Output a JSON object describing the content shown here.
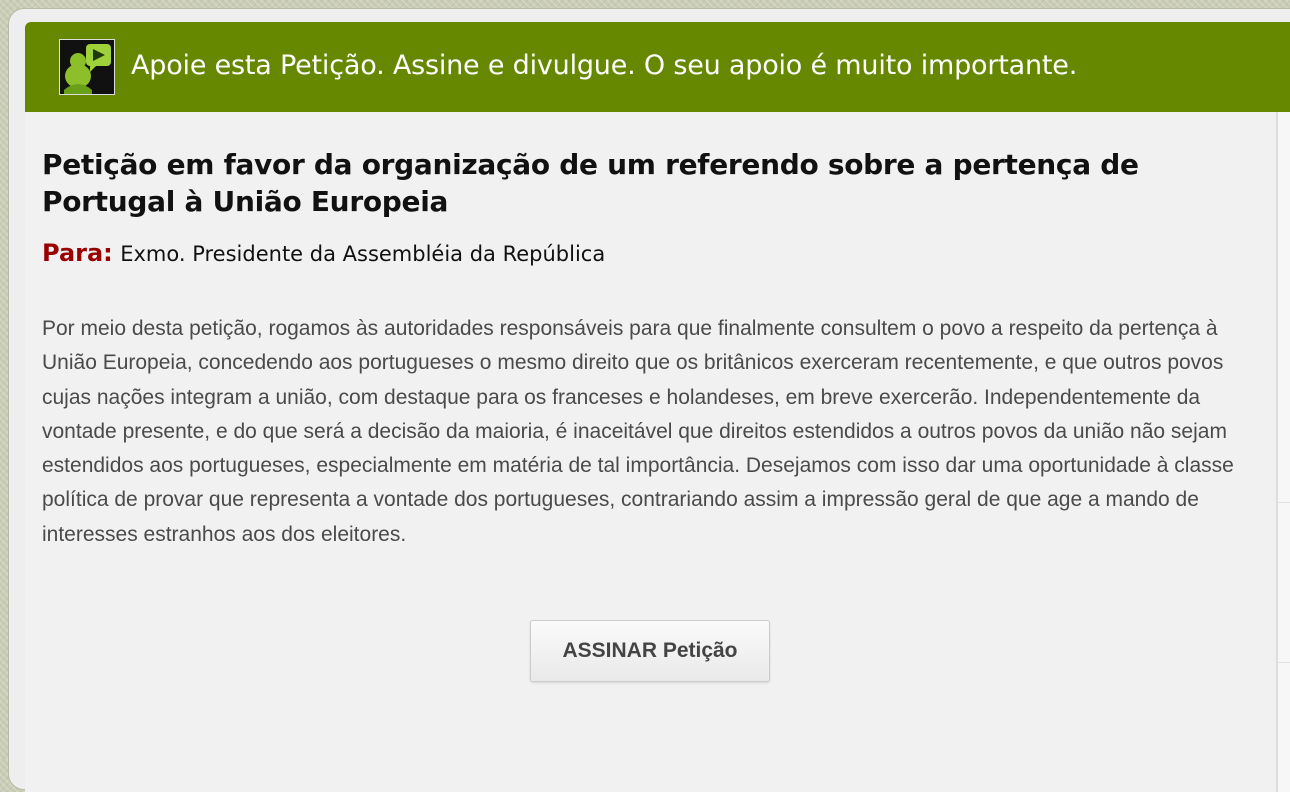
{
  "banner": {
    "icon": "person-play-icon",
    "text": "Apoie esta Petição. Assine e divulgue. O seu apoio é muito importante."
  },
  "petition": {
    "title": "Petição em favor da organização de um referendo sobre a pertença de Portugal à União Europeia",
    "recipient_label": "Para:",
    "recipient_value": "Exmo. Presidente da Assembléia da República",
    "body": "Por meio desta petição, rogamos às autoridades responsáveis para que finalmente consultem o povo a respeito da pertença à União Europeia, concedendo aos portugueses o mesmo direito que os britânicos exerceram recentemente, e que outros povos cujas nações integram a união, com destaque para os franceses e holandeses, em breve exercerão. Independentemente da vontade presente, e do que será a decisão da maioria, é inaceitável que direitos estendidos a outros povos da união não sejam estendidos aos portugueses, especialmente em matéria de tal importância. Desejamos com isso dar uma oportunidade à classe política de provar que representa a vontade dos portugueses, contrariando assim a impressão geral de que age a mando de interesses estranhos aos dos eleitores."
  },
  "actions": {
    "sign_label": "ASSINAR Petição"
  },
  "colors": {
    "banner_bg": "#668800",
    "recipient_label": "#990000",
    "body_text": "#4a4a4a"
  }
}
